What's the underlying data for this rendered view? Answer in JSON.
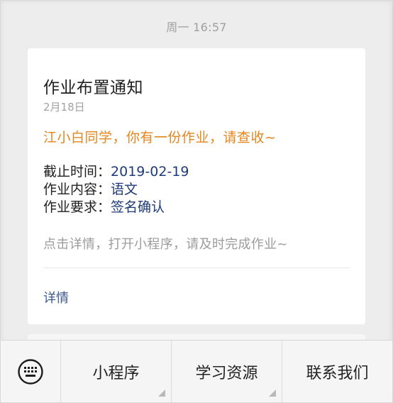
{
  "message_time": "周一 16:57",
  "card": {
    "title": "作业布置通知",
    "date": "2月18日",
    "notice": "江小白同学，你有一份作业，请查收~",
    "fields": [
      {
        "label": "截止时间：",
        "value": "2019-02-19"
      },
      {
        "label": "作业内容：",
        "value": "语文"
      },
      {
        "label": "作业要求：",
        "value": "签名确认"
      }
    ],
    "hint": "点击详情，打开小程序，请及时完成作业~",
    "detail_label": "详情"
  },
  "bottom_menu": {
    "keyboard_icon": "keyboard-icon",
    "items": [
      {
        "label": "小程序",
        "has_submenu": true
      },
      {
        "label": "学习资源",
        "has_submenu": true
      },
      {
        "label": "联系我们",
        "has_submenu": false
      }
    ]
  },
  "colors": {
    "notice": "#e4861e",
    "field_value": "#1e3b79",
    "link": "#3c5a91",
    "hint": "#9c9c9c",
    "background": "#ededed"
  }
}
